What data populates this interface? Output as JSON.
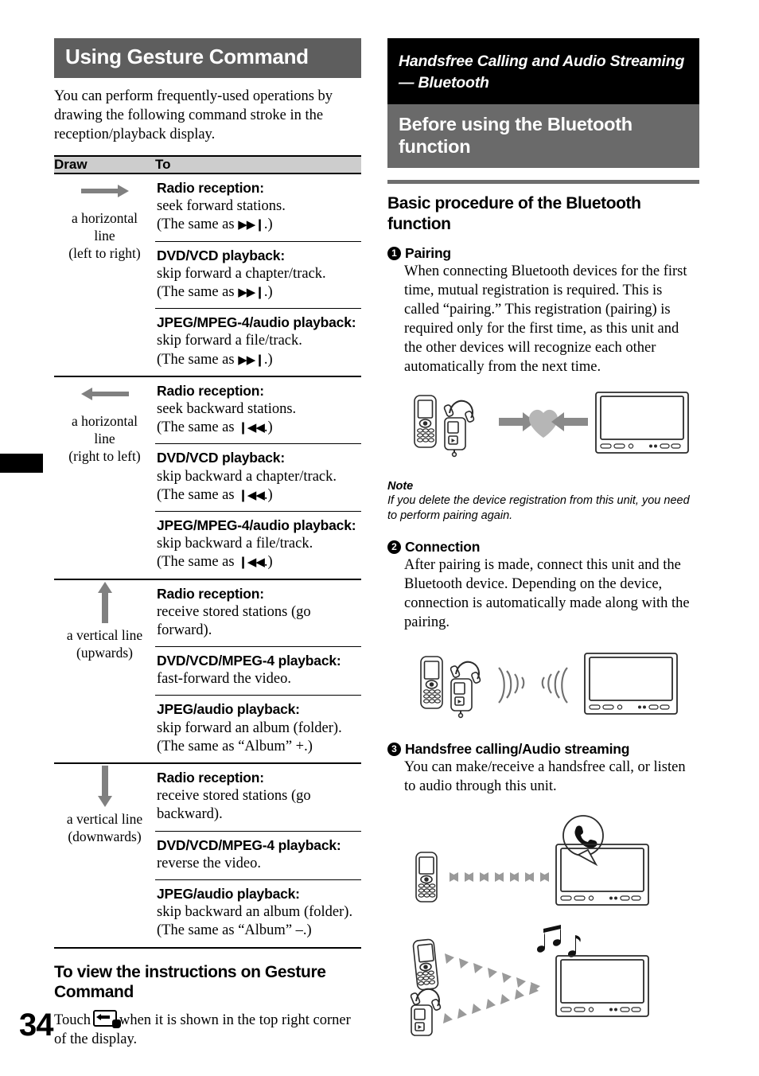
{
  "page_number": "34",
  "left_column": {
    "title": "Using Gesture Command",
    "intro": "You can perform frequently-used operations by drawing the following command stroke in the reception/playback display.",
    "table": {
      "headers": {
        "draw": "Draw",
        "to": "To"
      },
      "rows": [
        {
          "icon": "arrow-right-icon",
          "draw_label_line1": "a horizontal",
          "draw_label_line2": "line",
          "draw_label_line3": "(left to right)",
          "items": [
            {
              "title": "Radio reception:",
              "text": "seek forward stations.",
              "same_as_prefix": "(The same as ",
              "same_as_symbol": "▶▶❙",
              "same_as_suffix": ".)"
            },
            {
              "title": "DVD/VCD playback:",
              "text": "skip forward a chapter/track.",
              "same_as_prefix": "(The same as ",
              "same_as_symbol": "▶▶❙",
              "same_as_suffix": ".)"
            },
            {
              "title": "JPEG/MPEG-4/audio playback:",
              "text": "skip forward a file/track.",
              "same_as_prefix": "(The same as ",
              "same_as_symbol": "▶▶❙",
              "same_as_suffix": ".)"
            }
          ]
        },
        {
          "icon": "arrow-left-icon",
          "draw_label_line1": "a horizontal",
          "draw_label_line2": "line",
          "draw_label_line3": "(right to left)",
          "items": [
            {
              "title": "Radio reception:",
              "text": "seek backward stations.",
              "same_as_prefix": "(The same as ",
              "same_as_symbol": "❙◀◀",
              "same_as_suffix": ".)"
            },
            {
              "title": "DVD/VCD playback:",
              "text": "skip backward a chapter/track.",
              "same_as_prefix": "(The same as ",
              "same_as_symbol": "❙◀◀",
              "same_as_suffix": ".)"
            },
            {
              "title": "JPEG/MPEG-4/audio playback:",
              "text": "skip backward a file/track.",
              "same_as_prefix": "(The same as ",
              "same_as_symbol": "❙◀◀",
              "same_as_suffix": ".)"
            }
          ]
        },
        {
          "icon": "arrow-up-icon",
          "draw_label_line1": "a vertical line",
          "draw_label_line2": "(upwards)",
          "draw_label_line3": "",
          "items": [
            {
              "title": "Radio reception:",
              "text": "receive stored stations (go forward).",
              "same_as_prefix": "",
              "same_as_symbol": "",
              "same_as_suffix": ""
            },
            {
              "title": "DVD/VCD/MPEG-4 playback:",
              "text": "fast-forward the video.",
              "same_as_prefix": "",
              "same_as_symbol": "",
              "same_as_suffix": ""
            },
            {
              "title": "JPEG/audio playback:",
              "text": "skip forward an album (folder).",
              "same_as_prefix": "",
              "same_as_symbol": "",
              "same_as_suffix": "(The same as “Album” +.)"
            }
          ]
        },
        {
          "icon": "arrow-down-icon",
          "draw_label_line1": "a vertical line",
          "draw_label_line2": "(downwards)",
          "draw_label_line3": "",
          "items": [
            {
              "title": "Radio reception:",
              "text": "receive stored stations (go backward).",
              "same_as_prefix": "",
              "same_as_symbol": "",
              "same_as_suffix": ""
            },
            {
              "title": "DVD/VCD/MPEG-4 playback:",
              "text": "reverse the video.",
              "same_as_prefix": "",
              "same_as_symbol": "",
              "same_as_suffix": ""
            },
            {
              "title": "JPEG/audio playback:",
              "text": "skip backward an album (folder).",
              "same_as_prefix": "",
              "same_as_symbol": "",
              "same_as_suffix": "(The same as “Album” –.)"
            }
          ]
        }
      ]
    },
    "bottom_section": {
      "heading": "To view the instructions on Gesture Command",
      "text_before_icon": "Touch",
      "text_after_icon": "when it is shown in the top right corner of the display."
    }
  },
  "right_column": {
    "chapter_band": "Handsfree Calling and Audio Streaming — Bluetooth",
    "section_band": "Before using the Bluetooth function",
    "subsection_title": "Basic procedure of the Bluetooth function",
    "steps": [
      {
        "number": "1",
        "title": "Pairing",
        "text": "When connecting Bluetooth devices for the first time, mutual registration is required. This is called “pairing.” This registration (pairing) is required only for the first time, as this unit and the other devices will recognize each other automatically from the next time."
      },
      {
        "number": "2",
        "title": "Connection",
        "text": "After pairing is made, connect this unit and the Bluetooth device. Depending on the device, connection is automatically made along with the pairing."
      },
      {
        "number": "3",
        "title": "Handsfree calling/Audio streaming",
        "text": "You can make/receive a handsfree call, or listen to audio through this unit."
      }
    ],
    "note": {
      "label": "Note",
      "text": "If you delete the device registration from this unit, you need to perform pairing again."
    },
    "figures": [
      {
        "name": "pairing-diagram",
        "elements": [
          "mobile-phone-icon",
          "audio-player-headphones-icon",
          "arrow-right-icon",
          "pairing-heart-icon",
          "arrow-left-icon",
          "car-av-unit-icon"
        ]
      },
      {
        "name": "connection-diagram",
        "elements": [
          "mobile-phone-icon",
          "audio-player-headphones-icon",
          "wireless-waves-icon",
          "wireless-waves-icon",
          "car-av-unit-icon"
        ]
      },
      {
        "name": "handsfree-calling-diagram",
        "elements": [
          "mobile-phone-icon",
          "arrow-stream-left-icon",
          "arrow-stream-right-icon",
          "phone-handset-bubble-icon",
          "car-av-unit-icon"
        ]
      },
      {
        "name": "audio-streaming-diagram",
        "elements": [
          "mobile-phone-icon",
          "audio-player-headphones-icon",
          "arrow-stream-right-icon",
          "music-notes-icon",
          "car-av-unit-icon"
        ]
      }
    ]
  },
  "colors": {
    "band_dark": "#5e5e5e",
    "band_gray": "#6a6a6a",
    "band_black": "#000000",
    "table_header_gray": "#cdcdcd",
    "arrow_gray": "#808080"
  }
}
